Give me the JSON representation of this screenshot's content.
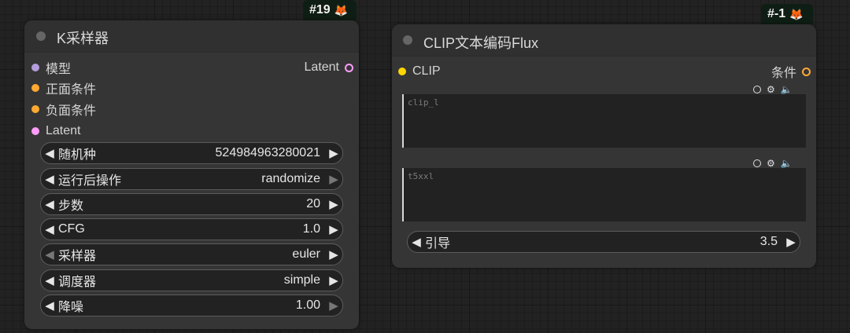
{
  "ksampler": {
    "badge_id": "#19",
    "title": "K采样器",
    "inputs": [
      "模型",
      "正面条件",
      "负面条件",
      "Latent"
    ],
    "output": "Latent",
    "widgets": [
      {
        "label": "随机种",
        "value": "524984963280021"
      },
      {
        "label": "运行后操作",
        "value": "randomize"
      },
      {
        "label": "步数",
        "value": "20"
      },
      {
        "label": "CFG",
        "value": "1.0"
      },
      {
        "label": "采样器",
        "value": "euler"
      },
      {
        "label": "调度器",
        "value": "simple"
      },
      {
        "label": "降噪",
        "value": "1.00"
      }
    ]
  },
  "clip_node": {
    "badge_id": "#-1",
    "title": "CLIP文本编码Flux",
    "input": "CLIP",
    "output": "条件",
    "textareas": [
      {
        "placeholder": "clip_l"
      },
      {
        "placeholder": "t5xxl"
      }
    ],
    "guidance": {
      "label": "引导",
      "value": "3.5"
    }
  },
  "colors": {
    "model_port": "#b39ddb",
    "conditioning_port": "#ffa931",
    "latent_port": "#ff9cf9",
    "clip_port": "#ffd500"
  }
}
